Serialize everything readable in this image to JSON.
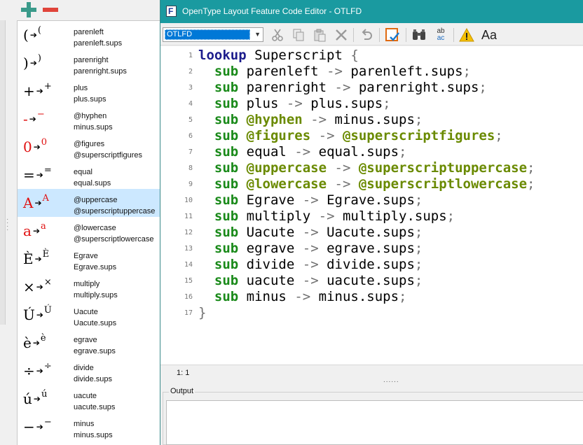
{
  "window": {
    "title": "OpenType Layout Feature Code Editor - OTLFD",
    "icon_letter": "F"
  },
  "left_toolbar": {
    "add_icon": "plus-icon",
    "remove_icon": "minus-icon"
  },
  "glyph_pairs": [
    {
      "base": "(",
      "sup": "(",
      "line1": "parenleft",
      "line2": "parenleft.sups",
      "red": false
    },
    {
      "base": ")",
      "sup": ")",
      "line1": "parenright",
      "line2": "parenright.sups",
      "red": false
    },
    {
      "base": "+",
      "sup": "+",
      "line1": "plus",
      "line2": "plus.sups",
      "red": false
    },
    {
      "base": "-",
      "sup": "−",
      "line1": "@hyphen",
      "line2": "minus.sups",
      "red": true
    },
    {
      "base": "0",
      "sup": "0",
      "line1": "@figures",
      "line2": "@superscriptfigures",
      "red": true
    },
    {
      "base": "=",
      "sup": "=",
      "line1": "equal",
      "line2": "equal.sups",
      "red": false
    },
    {
      "base": "A",
      "sup": "A",
      "line1": "@uppercase",
      "line2": "@superscriptuppercase",
      "red": true,
      "selected": true
    },
    {
      "base": "a",
      "sup": "a",
      "line1": "@lowercase",
      "line2": "@superscriptlowercase",
      "red": true
    },
    {
      "base": "È",
      "sup": "È",
      "line1": "Egrave",
      "line2": "Egrave.sups",
      "red": false
    },
    {
      "base": "×",
      "sup": "×",
      "line1": "multiply",
      "line2": "multiply.sups",
      "red": false
    },
    {
      "base": "Ú",
      "sup": "Ú",
      "line1": "Uacute",
      "line2": "Uacute.sups",
      "red": false
    },
    {
      "base": "è",
      "sup": "è",
      "line1": "egrave",
      "line2": "egrave.sups",
      "red": false
    },
    {
      "base": "÷",
      "sup": "÷",
      "line1": "divide",
      "line2": "divide.sups",
      "red": false
    },
    {
      "base": "ú",
      "sup": "ú",
      "line1": "uacute",
      "line2": "uacute.sups",
      "red": false
    },
    {
      "base": "−",
      "sup": "−",
      "line1": "minus",
      "line2": "minus.sups",
      "red": false
    }
  ],
  "toolbar": {
    "mode_select_value": "OTLFD",
    "icons": [
      "cut-icon",
      "copy-icon",
      "paste-icon",
      "delete-icon",
      "undo-icon",
      "validate-icon",
      "find-icon",
      "replace-icon",
      "warning-icon",
      "font-icon"
    ],
    "font_label": "Aa",
    "replace_label_top": "ab",
    "replace_label_bottom": "ac"
  },
  "code": {
    "lookup_name": "Superscript",
    "open_line": "lookup Superscript {",
    "close_line": "}",
    "subs": [
      {
        "from": "parenleft",
        "to": "parenleft.sups",
        "from_cls": false,
        "to_cls": false
      },
      {
        "from": "parenright",
        "to": "parenright.sups",
        "from_cls": false,
        "to_cls": false
      },
      {
        "from": "plus",
        "to": "plus.sups",
        "from_cls": false,
        "to_cls": false
      },
      {
        "from": "@hyphen",
        "to": "minus.sups",
        "from_cls": true,
        "to_cls": false
      },
      {
        "from": "@figures",
        "to": "@superscriptfigures",
        "from_cls": true,
        "to_cls": true
      },
      {
        "from": "equal",
        "to": "equal.sups",
        "from_cls": false,
        "to_cls": false
      },
      {
        "from": "@uppercase",
        "to": "@superscriptuppercase",
        "from_cls": true,
        "to_cls": true
      },
      {
        "from": "@lowercase",
        "to": "@superscriptlowercase",
        "from_cls": true,
        "to_cls": true
      },
      {
        "from": "Egrave",
        "to": "Egrave.sups",
        "from_cls": false,
        "to_cls": false
      },
      {
        "from": "multiply",
        "to": "multiply.sups",
        "from_cls": false,
        "to_cls": false
      },
      {
        "from": "Uacute",
        "to": "Uacute.sups",
        "from_cls": false,
        "to_cls": false
      },
      {
        "from": "egrave",
        "to": "egrave.sups",
        "from_cls": false,
        "to_cls": false
      },
      {
        "from": "divide",
        "to": "divide.sups",
        "from_cls": false,
        "to_cls": false
      },
      {
        "from": "uacute",
        "to": "uacute.sups",
        "from_cls": false,
        "to_cls": false
      },
      {
        "from": "minus",
        "to": "minus.sups",
        "from_cls": false,
        "to_cls": false
      }
    ]
  },
  "status": {
    "cursor_position": "1: 1"
  },
  "output": {
    "label": "Output",
    "text": ""
  },
  "colors": {
    "titlebar": "#1a9aa0",
    "keyword_lookup": "#1c1c8c",
    "keyword_sub": "#1a8a1a",
    "glyph_class": "#6a8a00",
    "selection": "#cce8ff"
  }
}
